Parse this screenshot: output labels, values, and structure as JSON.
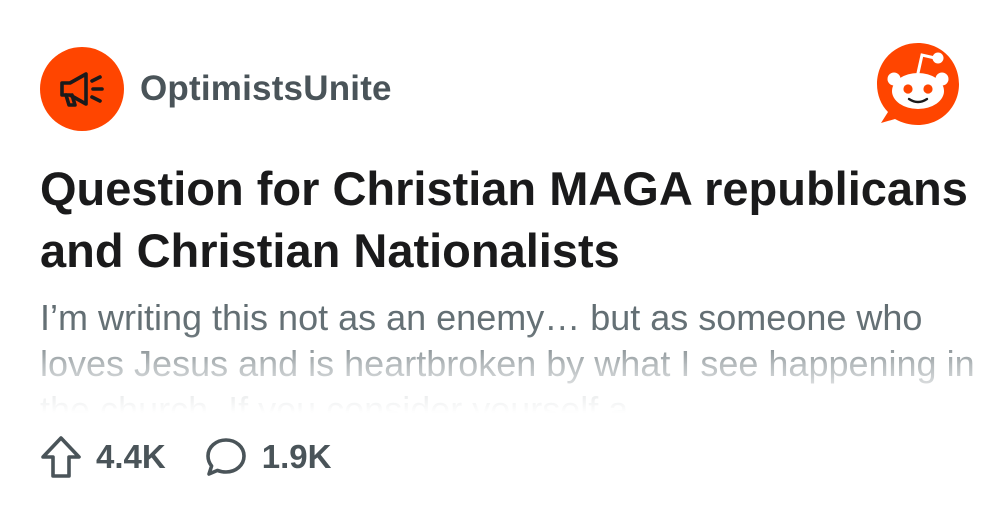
{
  "community": {
    "name": "OptimistsUnite",
    "icon": "megaphone-icon",
    "icon_bg": "#ff4500"
  },
  "brand": {
    "logo": "reddit-snoo-icon",
    "color": "#ff4500"
  },
  "post": {
    "title": "Question for Christian MAGA republicans and Christian Nationalists",
    "body": "I’m writing this not as an enemy… but as someone who loves Jesus and is heartbroken by what I see happening in the church. If you consider yourself a"
  },
  "actions": {
    "upvotes": {
      "icon": "upvote-arrow-icon",
      "count": "4.4K"
    },
    "comments": {
      "icon": "comment-bubble-icon",
      "count": "1.9K"
    }
  }
}
